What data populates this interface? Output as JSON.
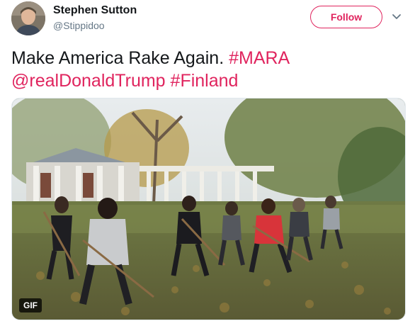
{
  "author": {
    "name": "Stephen Sutton",
    "handle": "@Stippidoo"
  },
  "follow_label": "Follow",
  "tweet": {
    "text_plain": "Make America Rake Again. ",
    "hashtag_1": "#MARA",
    "mention": "@realDonaldTrump",
    "hashtag_2": "#Finland"
  },
  "media": {
    "badge": "GIF"
  },
  "colors": {
    "accent": "#e0245e",
    "text": "#14171a",
    "secondary": "#657786"
  },
  "icons": {
    "menu": "chevron-down-icon"
  }
}
